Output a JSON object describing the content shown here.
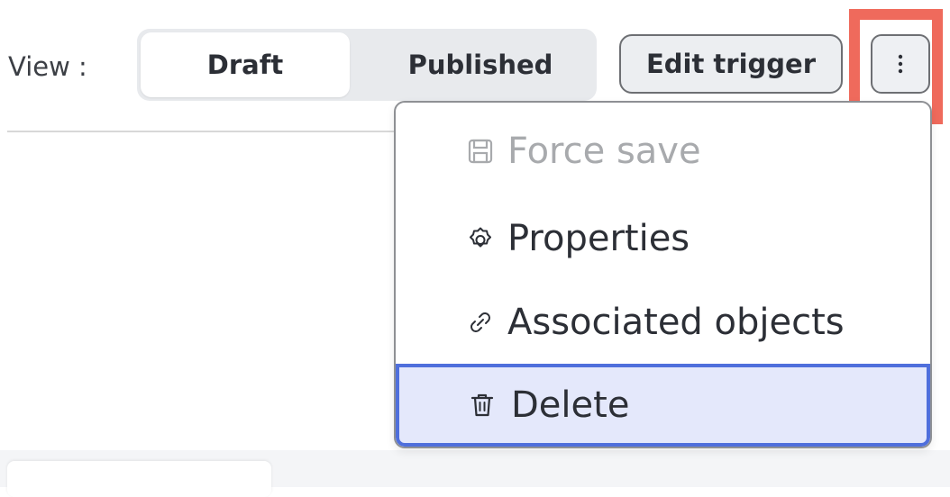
{
  "header": {
    "view_label": "View :",
    "toggle": {
      "options": [
        "Draft",
        "Published"
      ],
      "selected": "Draft"
    },
    "edit_trigger_label": "Edit trigger",
    "more_button_icon": "vertical-ellipsis-icon"
  },
  "menu": {
    "items": [
      {
        "label": "Force save",
        "icon": "save-icon",
        "disabled": true
      },
      {
        "label": "Properties",
        "icon": "gear-icon",
        "disabled": false
      },
      {
        "label": "Associated objects",
        "icon": "link-icon",
        "disabled": false
      },
      {
        "label": "Delete",
        "icon": "trash-icon",
        "disabled": false,
        "highlighted": true
      }
    ]
  },
  "colors": {
    "highlight_box": "#ef6a5c",
    "delete_highlight_border": "#4f6fdc",
    "delete_highlight_bg": "#e4e8fb",
    "disabled_text": "#a8aaad"
  }
}
